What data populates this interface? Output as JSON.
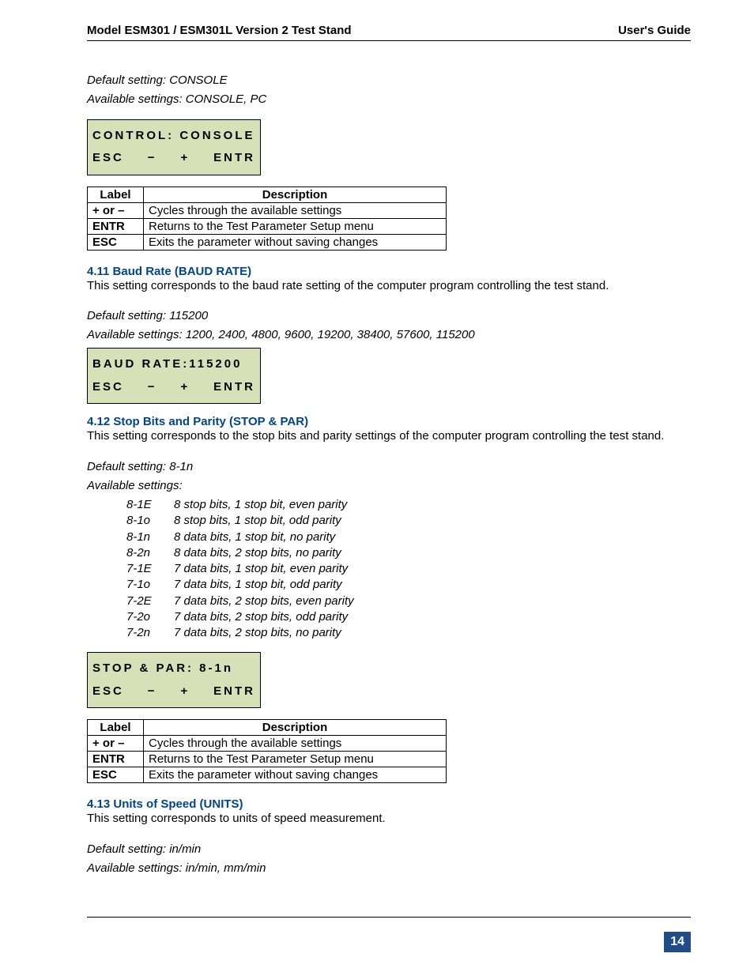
{
  "header": {
    "left": "Model ESM301 / ESM301L Version 2 Test Stand",
    "right": "User's Guide"
  },
  "intro": {
    "default": "Default setting: CONSOLE",
    "available": "Available settings: CONSOLE, PC"
  },
  "lcd1": {
    "line1": "CONTROL: CONSOLE",
    "esc": "ESC",
    "minus": "−",
    "plus": "+",
    "entr": "ENTR"
  },
  "table1": {
    "h1": "Label",
    "h2": "Description",
    "r1a": "+ or –",
    "r1b": "Cycles through the available settings",
    "r2a": "ENTR",
    "r2b": "Returns to the Test Parameter Setup menu",
    "r3a": "ESC",
    "r3b": "Exits the parameter without saving changes"
  },
  "sec411": {
    "title": "4.11 Baud Rate (BAUD RATE)",
    "text": "This setting corresponds to the baud rate setting of the computer program controlling the test stand.",
    "default": "Default setting: 115200",
    "available": "Available settings: 1200, 2400, 4800, 9600, 19200, 38400, 57600, 115200"
  },
  "lcd2": {
    "line1": "BAUD RATE:115200",
    "esc": "ESC",
    "minus": "−",
    "plus": "+",
    "entr": "ENTR"
  },
  "sec412": {
    "title": "4.12 Stop Bits and Parity (STOP & PAR)",
    "text": "This setting corresponds to the stop bits and parity settings of the computer program controlling the test stand.",
    "default": "Default setting: 8-1n",
    "available": "Available settings:"
  },
  "settings": [
    {
      "c": "8-1E",
      "d": "8 stop bits, 1 stop bit, even parity"
    },
    {
      "c": "8-1o",
      "d": "8 stop bits, 1 stop bit, odd parity"
    },
    {
      "c": "8-1n",
      "d": "8 data bits, 1 stop bit, no parity"
    },
    {
      "c": "8-2n",
      "d": "8 data bits, 2 stop bits, no parity"
    },
    {
      "c": "7-1E",
      "d": "7 data bits, 1 stop bit, even parity"
    },
    {
      "c": "7-1o",
      "d": "7 data bits, 1 stop bit, odd parity"
    },
    {
      "c": "7-2E",
      "d": "7 data bits, 2 stop bits, even parity"
    },
    {
      "c": "7-2o",
      "d": "7 data bits, 2 stop bits, odd parity"
    },
    {
      "c": "7-2n",
      "d": "7 data bits, 2 stop bits, no parity"
    }
  ],
  "lcd3": {
    "line1": "STOP & PAR: 8-1n",
    "esc": "ESC",
    "minus": "−",
    "plus": "+",
    "entr": "ENTR"
  },
  "table2": {
    "h1": "Label",
    "h2": "Description",
    "r1a": "+ or –",
    "r1b": "Cycles through the available settings",
    "r2a": "ENTR",
    "r2b": "Returns to the Test Parameter Setup menu",
    "r3a": "ESC",
    "r3b": "Exits the parameter without saving changes"
  },
  "sec413": {
    "title": "4.13 Units of Speed (UNITS)",
    "text": "This setting corresponds to units of speed measurement.",
    "default": "Default setting: in/min",
    "available": "Available settings: in/min, mm/min"
  },
  "page_number": "14"
}
